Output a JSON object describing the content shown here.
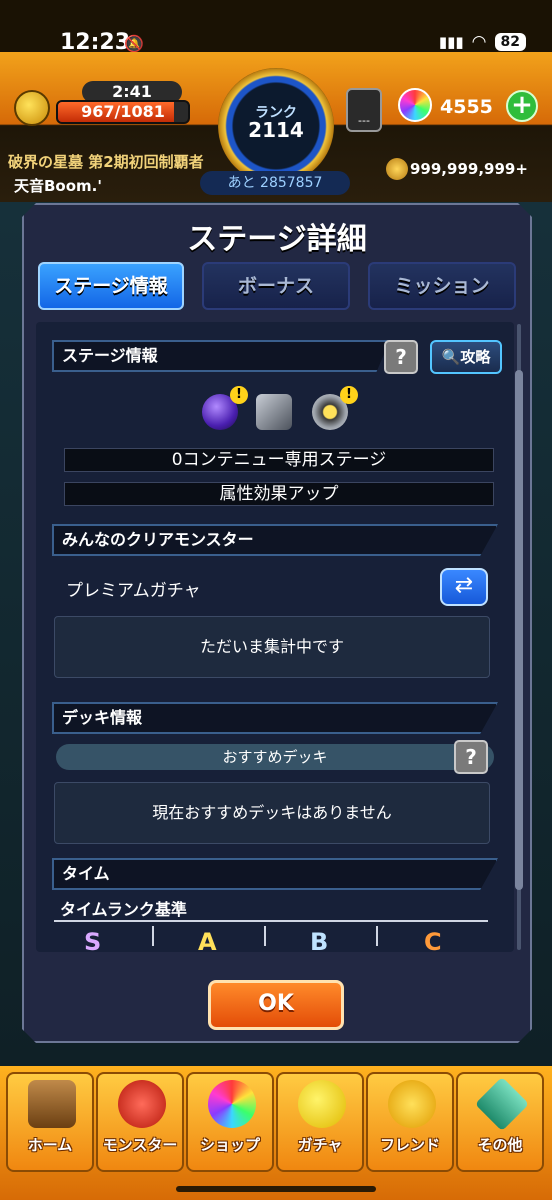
{
  "status_bar": {
    "time": "12:23",
    "battery": "82"
  },
  "hud": {
    "stamina_timer": "2:41",
    "stamina": "967/1081",
    "stamina_fraction": 0.894,
    "rank_label": "ランク",
    "rank_value": "2114",
    "rank_next": "あと 2857857",
    "title": "破界の星墓 第2期初回制覇者",
    "player_name": "天音Boom.'",
    "orb_machine_label": "---",
    "orb_count": "4555",
    "orb_plus": "+",
    "coins": "999,999,999+"
  },
  "modal": {
    "title": "ステージ詳細",
    "tabs": [
      {
        "label": "ステージ情報",
        "active": true
      },
      {
        "label": "ボーナス",
        "active": false
      },
      {
        "label": "ミッション",
        "active": false
      }
    ],
    "stage_info": {
      "header": "ステージ情報",
      "help": "?",
      "guide_label": "攻略",
      "rules": [
        "0コンテニュー専用ステージ",
        "属性効果アップ"
      ],
      "gimmick_icons": [
        "dark-orb-gimmick-icon",
        "block-gimmick-icon",
        "gravity-barrier-gimmick-icon"
      ]
    },
    "clear_monsters": {
      "header": "みんなのクリアモンスター",
      "filter_label": "プレミアムガチャ",
      "message": "ただいま集計中です"
    },
    "deck": {
      "header": "デッキ情報",
      "recommend_label": "おすすめデッキ",
      "help": "?",
      "message": "現在おすすめデッキはありません"
    },
    "time": {
      "header": "タイム",
      "rank_criteria": "タイムランク基準",
      "ranks": [
        "S",
        "A",
        "B",
        "C"
      ]
    },
    "ok_label": "OK"
  },
  "nav": {
    "items": [
      {
        "label": "ホーム",
        "icon": "home-gate-icon"
      },
      {
        "label": "モンスター",
        "icon": "dragon-icon"
      },
      {
        "label": "ショップ",
        "icon": "rainbow-orb-icon"
      },
      {
        "label": "ガチャ",
        "icon": "egg-icon"
      },
      {
        "label": "フレンド",
        "icon": "friends-icon"
      },
      {
        "label": "その他",
        "icon": "diamond-menu-icon"
      }
    ]
  },
  "colors": {
    "accent_blue": "#1366e6",
    "ok_orange": "#e34d08",
    "nav_gold": "#ffb21f"
  }
}
